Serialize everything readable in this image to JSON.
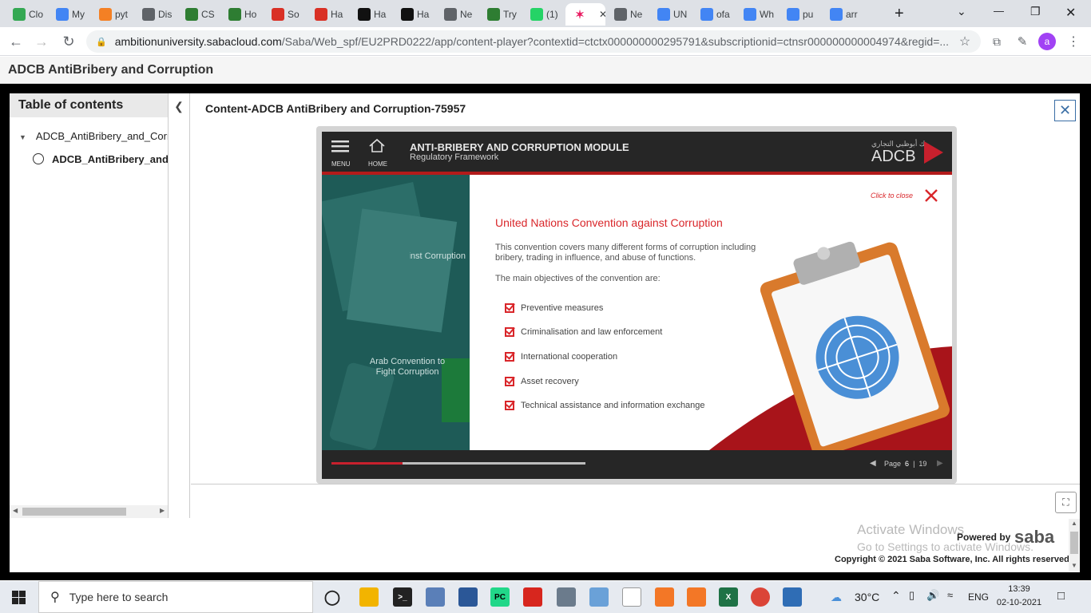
{
  "browser": {
    "tabs": [
      {
        "label": "Clo",
        "icon": "google-drive-icon",
        "color": "#34a853"
      },
      {
        "label": "My",
        "icon": "google-drive-icon",
        "color": "#4285f4"
      },
      {
        "label": "pyt",
        "icon": "stackoverflow-icon",
        "color": "#f48024"
      },
      {
        "label": "Dis",
        "icon": "globe-icon",
        "color": "#5f6368"
      },
      {
        "label": "CS",
        "icon": "w-icon",
        "color": "#2e7d32"
      },
      {
        "label": "Ho",
        "icon": "w-icon",
        "color": "#2e7d32"
      },
      {
        "label": "So",
        "icon": "gmail-icon",
        "color": "#d93025"
      },
      {
        "label": "Ha",
        "icon": "gmail-icon",
        "color": "#d93025"
      },
      {
        "label": "Ha",
        "icon": "hackerrank-icon",
        "color": "#111111"
      },
      {
        "label": "Ha",
        "icon": "hackerrank-icon",
        "color": "#111111"
      },
      {
        "label": "Ne",
        "icon": "globe-icon",
        "color": "#5f6368"
      },
      {
        "label": "Try",
        "icon": "w-icon",
        "color": "#2e7d32"
      },
      {
        "label": "(1)",
        "icon": "whatsapp-icon",
        "color": "#25d366"
      },
      {
        "label": "",
        "icon": "saba-icon",
        "color": "#ffffff",
        "active": true
      },
      {
        "label": "Ne",
        "icon": "globe-icon",
        "color": "#5f6368"
      },
      {
        "label": "UN",
        "icon": "google-icon",
        "color": "#4285f4"
      },
      {
        "label": "ofa",
        "icon": "google-icon",
        "color": "#4285f4"
      },
      {
        "label": "Wh",
        "icon": "google-icon",
        "color": "#4285f4"
      },
      {
        "label": "pu",
        "icon": "google-icon",
        "color": "#4285f4"
      },
      {
        "label": "arr",
        "icon": "google-icon",
        "color": "#4285f4"
      }
    ],
    "url_host": "ambitionuniversity.sabacloud.com",
    "url_path": "/Saba/Web_spf/EU2PRD0222/app/content-player?contextid=ctctx000000000295791&subscriptionid=ctnsr000000000004974&regid=...",
    "profile_initial": "a"
  },
  "saba": {
    "header_title": "ADCB AntiBribery and Corruption",
    "toc": {
      "title": "Table of contents",
      "parent_item": "ADCB_AntiBribery_and_Corruption",
      "child_item": "ADCB_AntiBribery_and_Corruption"
    },
    "content_title": "Content-ADCB AntiBribery and Corruption-75957",
    "footer": {
      "activate_line1": "Activate Windows",
      "activate_line2": "Go to Settings to activate Windows.",
      "powered_by": "Powered by",
      "saba_logo": "saba",
      "copyright": "Copyright © 2021 Saba Software, Inc. All rights reserved."
    }
  },
  "player": {
    "menu_label": "MENU",
    "home_label": "HOME",
    "module_title": "ANTI-BRIBERY AND CORRUPTION MODULE",
    "module_subtitle": "Regulatory Framework",
    "logo_arabic": "بنك أبوظبي التجاري",
    "logo": "ADCB",
    "left_text1": "United Nations Convention against Corruption",
    "left_text2": "Arab Convention to Fight Corruption",
    "click_to_close": "Click to close",
    "slide_title": "United Nations Convention against Corruption",
    "slide_paragraph": "This convention covers many different forms of corruption including bribery, trading in influence, and abuse of functions.",
    "objectives_intro": "The main objectives of the convention are:",
    "objectives": [
      "Preventive measures",
      "Criminalisation and law enforcement",
      "International cooperation",
      "Asset recovery",
      "Technical assistance and information exchange"
    ],
    "page_label": "Page",
    "page_current": "6",
    "page_total": "19",
    "progress_fraction": 0.28,
    "accent_color": "#d9262a"
  },
  "taskbar": {
    "search_placeholder": "Type here to search",
    "temperature": "30°C",
    "language": "ENG",
    "time": "13:39",
    "date": "02-10-2021"
  }
}
